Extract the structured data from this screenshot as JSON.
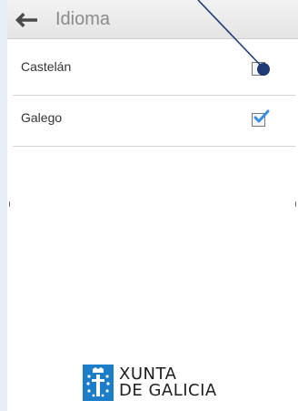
{
  "header": {
    "back_icon": "arrow-left-icon",
    "title": "Idioma"
  },
  "options": [
    {
      "label": "Castelán",
      "checked": false
    },
    {
      "label": "Galego",
      "checked": true
    }
  ],
  "brand": {
    "line1": "XUNTA",
    "line2": "DE GALICIA",
    "seal_icon": "galicia-seal-icon"
  },
  "colors": {
    "header_background": "#e9e9e9",
    "header_text": "#8b8b8b",
    "checkmark": "#3a8dde",
    "brand_blue": "#1c7ec8",
    "annotation": "#1f3b73"
  }
}
